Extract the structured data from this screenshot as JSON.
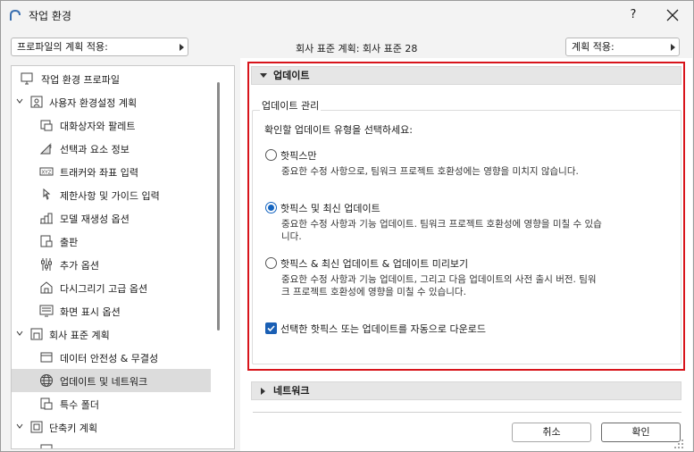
{
  "window": {
    "title": "작업 환경",
    "help_label": "?"
  },
  "top": {
    "apply_profile_label": "프로파일의 계획 적용:",
    "company_standard": "회사 표준 계획: 회사 표준 28",
    "apply_scheme_label": "계획 적용:"
  },
  "tree": {
    "items": [
      {
        "label": "작업 환경 프로파일",
        "icon": "monitor-profile-icon",
        "level": 0
      },
      {
        "label": "사용자 환경설정 계획",
        "icon": "user-scheme-icon",
        "level": 0,
        "expanded": true
      },
      {
        "label": "대화상자와 팔레트",
        "icon": "dialog-palette-icon",
        "level": 1
      },
      {
        "label": "선택과 요소 정보",
        "icon": "selection-info-icon",
        "level": 1
      },
      {
        "label": "트래커와 좌표 입력",
        "icon": "tracker-xyz-icon",
        "level": 1
      },
      {
        "label": "제한사항 및 가이드 입력",
        "icon": "constraint-guide-icon",
        "level": 1
      },
      {
        "label": "모델 재생성 옵션",
        "icon": "model-rebuild-icon",
        "level": 1
      },
      {
        "label": "출판",
        "icon": "publish-icon",
        "level": 1
      },
      {
        "label": "추가 옵션",
        "icon": "more-options-icon",
        "level": 1
      },
      {
        "label": "다시그리기 고급 옵션",
        "icon": "redraw-icon",
        "level": 1
      },
      {
        "label": "화면 표시 옵션",
        "icon": "display-icon",
        "level": 1
      },
      {
        "label": "회사 표준 계획",
        "icon": "company-scheme-icon",
        "level": 0,
        "expanded": true
      },
      {
        "label": "데이터 안전성 & 무결성",
        "icon": "data-safety-icon",
        "level": 1
      },
      {
        "label": "업데이트 및 네트워크",
        "icon": "globe-icon",
        "level": 1,
        "selected": true
      },
      {
        "label": "특수 폴더",
        "icon": "special-folder-icon",
        "level": 1
      },
      {
        "label": "단축키 계획",
        "icon": "shortcut-scheme-icon",
        "level": 0,
        "expanded": true
      }
    ]
  },
  "update_section": {
    "header": "업데이트",
    "group_label": "업데이트 관리",
    "prompt": "확인할 업데이트 유형을 선택하세요:",
    "options": [
      {
        "label": "핫픽스만",
        "desc": "중요한 수정 사항으로, 팀워크 프로젝트 호환성에는 영향을 미치지 않습니다.",
        "selected": false
      },
      {
        "label": "핫픽스 및 최신 업데이트",
        "desc_line1": "중요한 수정 사항과 기능 업데이트. 팀워크 프로젝트 호환성에 영향을 미칠 수 있습",
        "desc_line2": "니다.",
        "selected": true
      },
      {
        "label": "핫픽스 & 최신 업데이트 & 업데이트 미리보기",
        "desc_line1": "중요한 수정 사항과 기능 업데이트, 그리고 다음 업데이트의 사전 출시 버전. 팀워",
        "desc_line2": "크 프로젝트 호환성에 영향을 미칠 수 있습니다.",
        "selected": false
      }
    ],
    "auto_download_label": "선택한 핫픽스 또는 업데이트를 자동으로 다운로드",
    "auto_download_checked": true
  },
  "network_section": {
    "header": "네트워크"
  },
  "buttons": {
    "cancel": "취소",
    "ok": "확인"
  },
  "colors": {
    "highlight_frame": "#d8141b",
    "accent": "#1565c0"
  }
}
